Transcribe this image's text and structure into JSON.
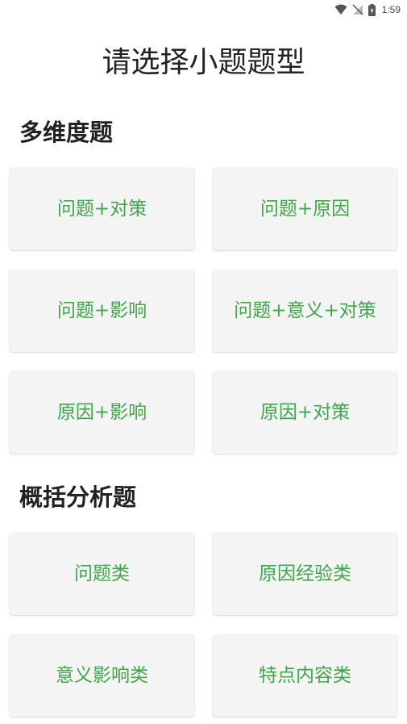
{
  "status_bar": {
    "time": "1:59",
    "icons": [
      "wifi-icon",
      "no-signal-icon",
      "battery-charging-icon"
    ]
  },
  "page": {
    "title": "请选择小题题型"
  },
  "sections": [
    {
      "title": "多维度题",
      "items": [
        {
          "label": "问题+对策"
        },
        {
          "label": "问题+原因"
        },
        {
          "label": "问题+影响"
        },
        {
          "label": "问题+意义+对策"
        },
        {
          "label": "原因+影响"
        },
        {
          "label": "原因+对策"
        }
      ]
    },
    {
      "title": "概括分析题",
      "items": [
        {
          "label": "问题类"
        },
        {
          "label": "原因经验类"
        },
        {
          "label": "意义影响类"
        },
        {
          "label": "特点内容类"
        }
      ]
    }
  ],
  "colors": {
    "accent_text": "#3fa64a",
    "card_background": "#f4f4f4",
    "title_text": "#222222"
  }
}
